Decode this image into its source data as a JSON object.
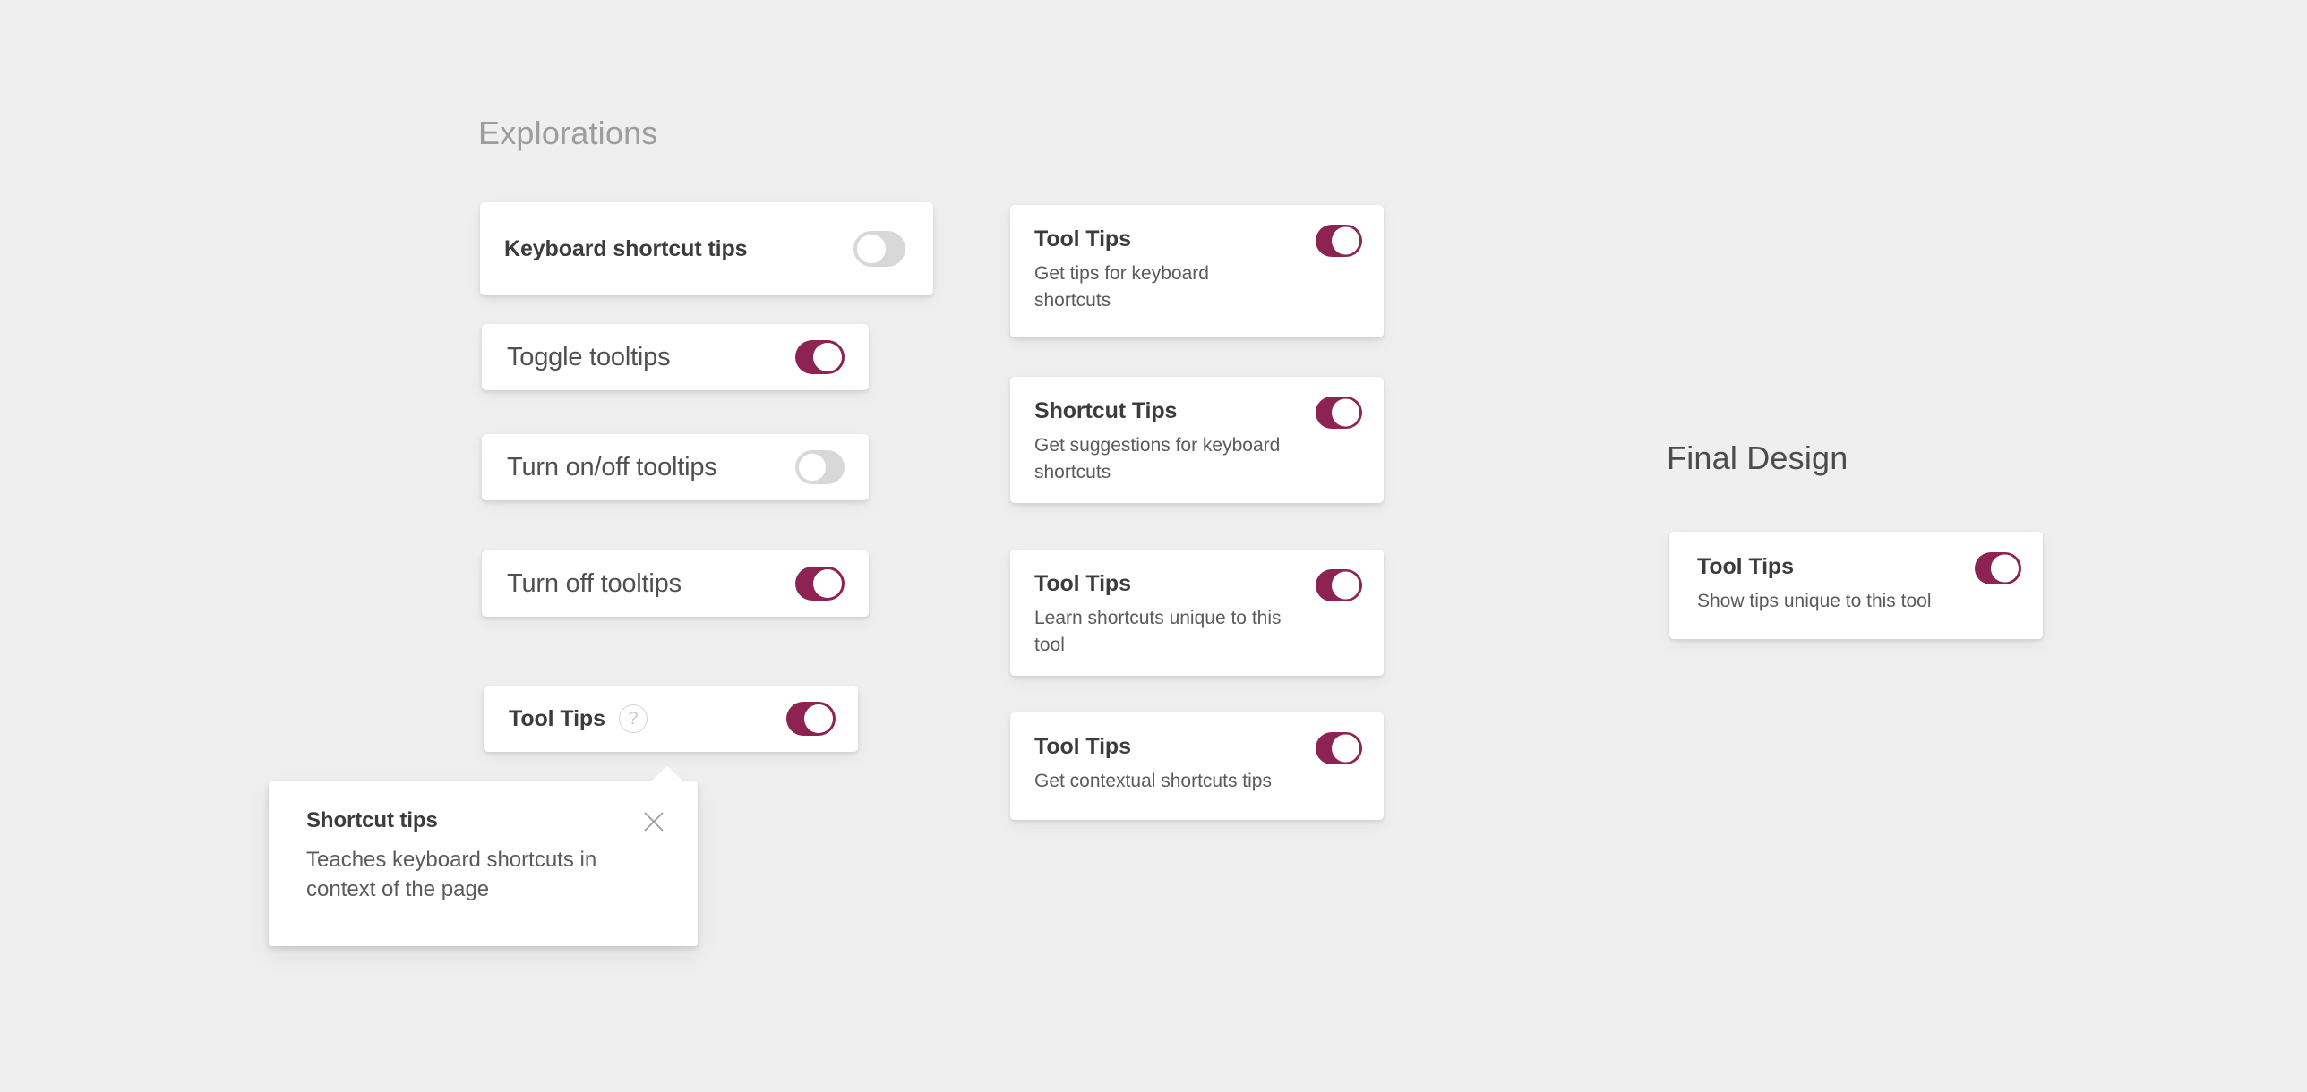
{
  "colors": {
    "background": "#efefef",
    "card": "#ffffff",
    "toggle_on": "#8d2352",
    "toggle_off": "#d8d8d8",
    "heading_muted": "#9d9d9d",
    "heading_dark": "#4c4c4c",
    "title_text": "#3c3c3c",
    "body_text": "#5b5b5b"
  },
  "explorations": {
    "heading": "Explorations",
    "left_column": [
      {
        "title": "Keyboard shortcut tips",
        "toggle": {
          "state": "off",
          "icon": "toggle-off-icon"
        }
      },
      {
        "title": "Toggle tooltips",
        "toggle": {
          "state": "on",
          "icon": "toggle-on-icon"
        }
      },
      {
        "title": "Turn on/off tooltips",
        "toggle": {
          "state": "off",
          "icon": "toggle-off-icon"
        }
      },
      {
        "title": "Turn off tooltips",
        "toggle": {
          "state": "on",
          "icon": "toggle-on-icon"
        }
      },
      {
        "title": "Tool Tips",
        "help_icon": "help-circle-icon",
        "help_glyph": "?",
        "toggle": {
          "state": "on",
          "icon": "toggle-on-icon"
        }
      }
    ],
    "right_column": [
      {
        "title": "Tool Tips",
        "description": "Get tips for keyboard shortcuts",
        "toggle": {
          "state": "on",
          "icon": "toggle-on-icon"
        }
      },
      {
        "title": "Shortcut Tips",
        "description": "Get suggestions for keyboard shortcuts",
        "toggle": {
          "state": "on",
          "icon": "toggle-on-icon"
        }
      },
      {
        "title": "Tool Tips",
        "description": "Learn shortcuts unique to this tool",
        "toggle": {
          "state": "on",
          "icon": "toggle-on-icon"
        }
      },
      {
        "title": "Tool Tips",
        "description": "Get contextual shortcuts tips",
        "toggle": {
          "state": "on",
          "icon": "toggle-on-icon"
        }
      }
    ]
  },
  "tooltip": {
    "title": "Shortcut tips",
    "body": "Teaches keyboard shortcuts in context of the page",
    "close_icon": "close-x-icon"
  },
  "final_design": {
    "heading": "Final Design",
    "card": {
      "title": "Tool Tips",
      "description": "Show tips unique to this tool",
      "toggle": {
        "state": "on",
        "icon": "toggle-on-icon"
      }
    }
  }
}
